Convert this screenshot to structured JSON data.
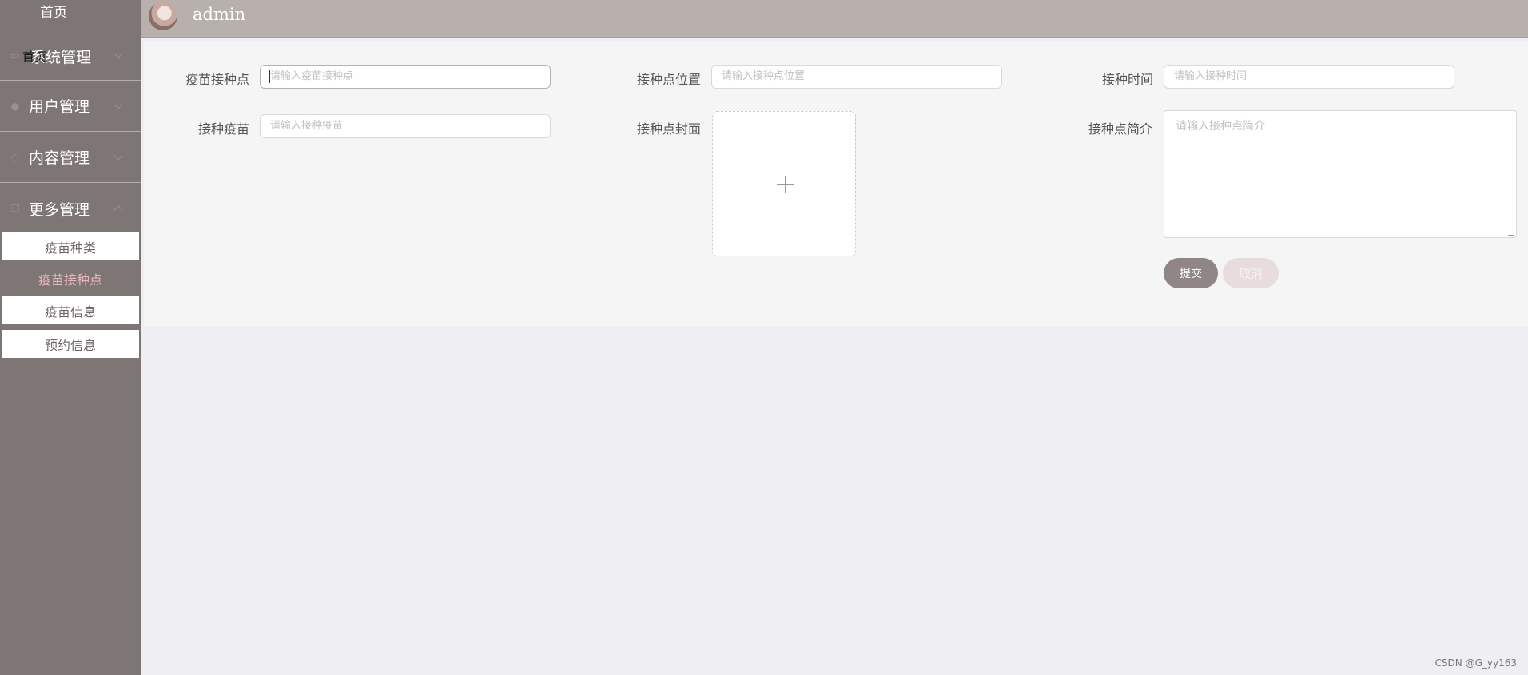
{
  "sidebar": {
    "home": "首页",
    "overlay_label": "首页",
    "groups": [
      {
        "label": "系统管理",
        "icon": "chat-icon"
      },
      {
        "label": "用户管理",
        "icon": "user-icon"
      },
      {
        "label": "内容管理",
        "icon": "content-icon"
      },
      {
        "label": "更多管理",
        "icon": "copy-icon"
      }
    ],
    "submenu": [
      {
        "label": "疫苗种类",
        "active": false
      },
      {
        "label": "疫苗接种点",
        "active": true
      },
      {
        "label": "疫苗信息",
        "active": false
      },
      {
        "label": "预约信息",
        "active": false
      }
    ]
  },
  "topbar": {
    "username": "admin"
  },
  "form": {
    "site": {
      "label": "疫苗接种点",
      "placeholder": "请输入疫苗接种点"
    },
    "location": {
      "label": "接种点位置",
      "placeholder": "请输入接种点位置"
    },
    "time": {
      "label": "接种时间",
      "placeholder": "请输入接种时间"
    },
    "vaccine": {
      "label": "接种疫苗",
      "placeholder": "请输入接种疫苗"
    },
    "cover": {
      "label": "接种点封面"
    },
    "intro": {
      "label": "接种点简介",
      "placeholder": "请输入接种点简介"
    },
    "submit": "提交",
    "cancel": "取消"
  },
  "watermark": "CSDN @G_yy163",
  "colors": {
    "sidebar": "#7d7674",
    "topbar": "#b8b0ad",
    "active_text": "#e9b8bd"
  }
}
